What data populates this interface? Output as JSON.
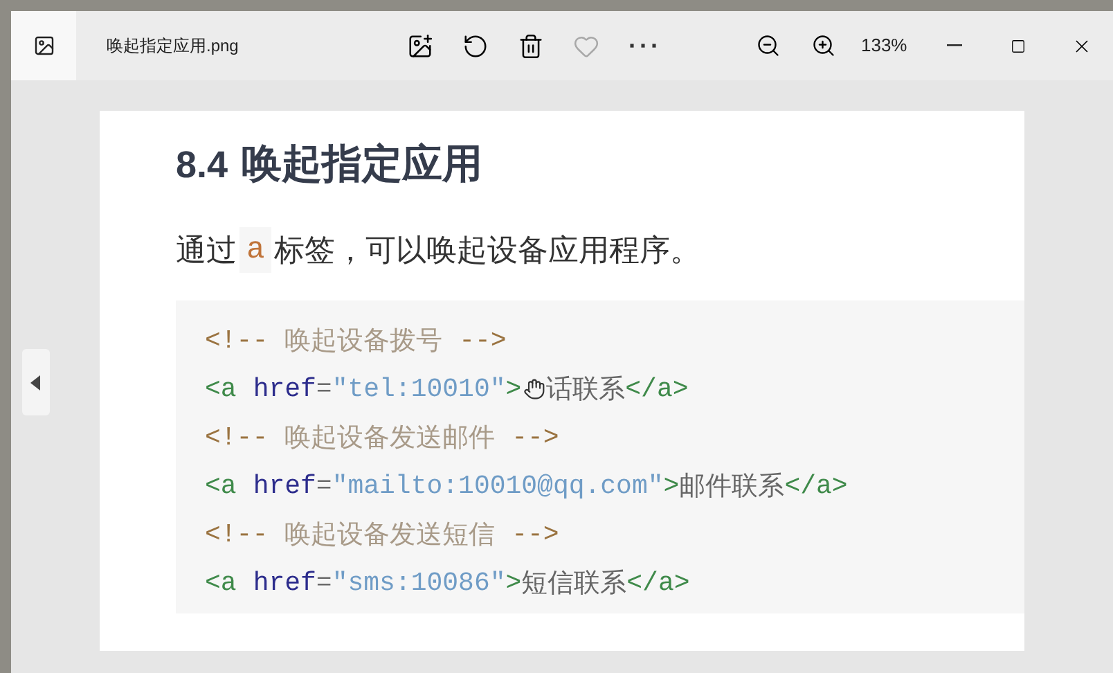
{
  "window": {
    "file_name": "唤起指定应用.png",
    "zoom": "133%"
  },
  "toolbar": [
    {
      "kind": "edit"
    },
    {
      "kind": "rotate"
    },
    {
      "kind": "delete"
    },
    {
      "kind": "favorite",
      "selected": false
    },
    {
      "kind": "more",
      "label": "···"
    }
  ],
  "document": {
    "heading_number": "8.4",
    "heading": "唤起指定应用",
    "intro": [
      {
        "kind": "text",
        "text": "通过"
      },
      {
        "kind": "code",
        "text": "a"
      },
      {
        "kind": "text",
        "text": "标签，可以唤起设备应用程序。"
      }
    ],
    "code_lines": [
      [
        {
          "kind": "comment",
          "text": "<!--"
        },
        {
          "kind": "comment_text",
          "text": "唤起设备拨号"
        },
        {
          "kind": "comment",
          "text": "-->"
        }
      ],
      [
        {
          "kind": "tag",
          "text": "<a"
        },
        {
          "kind": "attr",
          "text": "href"
        },
        {
          "kind": "punct",
          "text": "="
        },
        {
          "kind": "string",
          "text": "\"tel:10010\""
        },
        {
          "kind": "tag",
          "text": ">"
        },
        {
          "kind": "cursor"
        },
        {
          "kind": "text",
          "text": "话联系"
        },
        {
          "kind": "tag",
          "text": "</a>"
        }
      ],
      [
        {
          "kind": "comment",
          "text": "<!--"
        },
        {
          "kind": "comment_text",
          "text": "唤起设备发送邮件"
        },
        {
          "kind": "comment",
          "text": "-->"
        }
      ],
      [
        {
          "kind": "tag",
          "text": "<a"
        },
        {
          "kind": "attr",
          "text": "href"
        },
        {
          "kind": "punct",
          "text": "="
        },
        {
          "kind": "string",
          "text": "\"mailto:10010@qq.com\""
        },
        {
          "kind": "tag",
          "text": ">"
        },
        {
          "kind": "text",
          "text": "邮件联系"
        },
        {
          "kind": "tag",
          "text": "</a>"
        }
      ],
      [
        {
          "kind": "comment",
          "text": "<!--"
        },
        {
          "kind": "comment_text",
          "text": "唤起设备发送短信"
        },
        {
          "kind": "comment",
          "text": "-->"
        }
      ],
      [
        {
          "kind": "tag",
          "text": "<a"
        },
        {
          "kind": "attr",
          "text": "href"
        },
        {
          "kind": "punct",
          "text": "="
        },
        {
          "kind": "string",
          "text": "\"sms:10086\""
        },
        {
          "kind": "tag",
          "text": ">"
        },
        {
          "kind": "text",
          "text": "短信联系"
        },
        {
          "kind": "tag",
          "text": "</a>"
        }
      ]
    ]
  }
}
